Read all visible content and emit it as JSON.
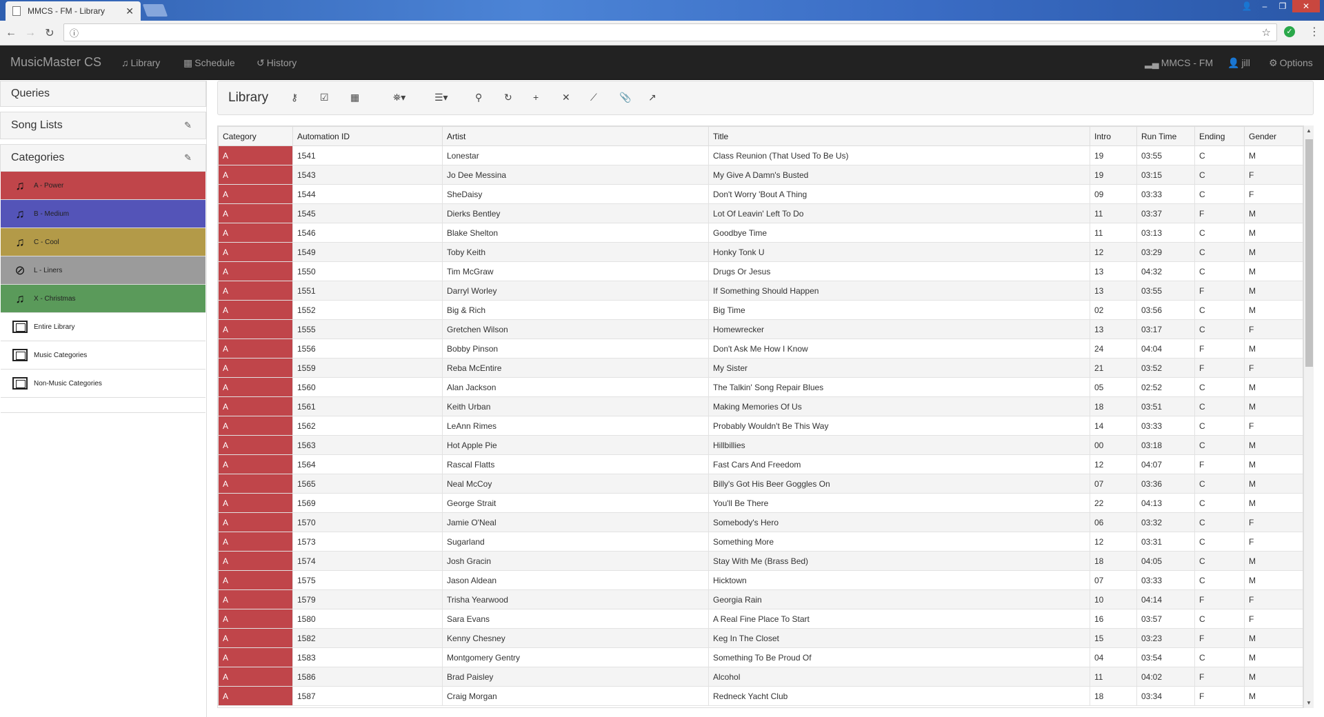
{
  "browser": {
    "tab_title": "MMCS - FM - Library",
    "tab_close": "✕",
    "url_icon": "ⓘ"
  },
  "navbar": {
    "brand": "MusicMaster CS",
    "library": "Library",
    "schedule": "Schedule",
    "history": "History",
    "station": "MMCS - FM",
    "user": "jill",
    "options": "Options"
  },
  "sidebar": {
    "queries": "Queries",
    "song_lists": "Song Lists",
    "categories": "Categories",
    "category_items": [
      {
        "label": "A - Power",
        "color": "#c0454a",
        "icon": "music-icon"
      },
      {
        "label": "B - Medium",
        "color": "#5454b8",
        "icon": "music-icon"
      },
      {
        "label": "C - Cool",
        "color": "#b39a48",
        "icon": "music-icon"
      },
      {
        "label": "L - Liners",
        "color": "#9b9b9b",
        "icon": "ban-icon"
      },
      {
        "label": "X - Christmas",
        "color": "#5a9a5a",
        "icon": "music-icon"
      },
      {
        "label": "Entire Library",
        "color": "#ffffff",
        "icon": "collection-icon"
      },
      {
        "label": "Music Categories",
        "color": "#ffffff",
        "icon": "collection-icon"
      },
      {
        "label": "Non-Music Categories",
        "color": "#ffffff",
        "icon": "collection-icon"
      }
    ]
  },
  "main": {
    "title": "Library",
    "columns": [
      "Category",
      "Automation ID",
      "Artist",
      "Title",
      "Intro",
      "Run Time",
      "Ending",
      "Gender"
    ],
    "rows": [
      [
        "A",
        "1541",
        "Lonestar",
        "Class Reunion (That Used To Be Us)",
        "19",
        "03:55",
        "C",
        "M"
      ],
      [
        "A",
        "1543",
        "Jo Dee Messina",
        "My Give A Damn's Busted",
        "19",
        "03:15",
        "C",
        "F"
      ],
      [
        "A",
        "1544",
        "SheDaisy",
        "Don't Worry 'Bout A Thing",
        "09",
        "03:33",
        "C",
        "F"
      ],
      [
        "A",
        "1545",
        "Dierks Bentley",
        "Lot Of Leavin' Left To Do",
        "11",
        "03:37",
        "F",
        "M"
      ],
      [
        "A",
        "1546",
        "Blake Shelton",
        "Goodbye Time",
        "11",
        "03:13",
        "C",
        "M"
      ],
      [
        "A",
        "1549",
        "Toby Keith",
        "Honky Tonk U",
        "12",
        "03:29",
        "C",
        "M"
      ],
      [
        "A",
        "1550",
        "Tim McGraw",
        "Drugs Or Jesus",
        "13",
        "04:32",
        "C",
        "M"
      ],
      [
        "A",
        "1551",
        "Darryl Worley",
        "If Something Should Happen",
        "13",
        "03:55",
        "F",
        "M"
      ],
      [
        "A",
        "1552",
        "Big & Rich",
        "Big Time",
        "02",
        "03:56",
        "C",
        "M"
      ],
      [
        "A",
        "1555",
        "Gretchen Wilson",
        "Homewrecker",
        "13",
        "03:17",
        "C",
        "F"
      ],
      [
        "A",
        "1556",
        "Bobby Pinson",
        "Don't Ask Me How I Know",
        "24",
        "04:04",
        "F",
        "M"
      ],
      [
        "A",
        "1559",
        "Reba McEntire",
        "My Sister",
        "21",
        "03:52",
        "F",
        "F"
      ],
      [
        "A",
        "1560",
        "Alan Jackson",
        "The Talkin' Song Repair Blues",
        "05",
        "02:52",
        "C",
        "M"
      ],
      [
        "A",
        "1561",
        "Keith Urban",
        "Making Memories Of Us",
        "18",
        "03:51",
        "C",
        "M"
      ],
      [
        "A",
        "1562",
        "LeAnn Rimes",
        "Probably Wouldn't Be This Way",
        "14",
        "03:33",
        "C",
        "F"
      ],
      [
        "A",
        "1563",
        "Hot Apple Pie",
        "Hillbillies",
        "00",
        "03:18",
        "C",
        "M"
      ],
      [
        "A",
        "1564",
        "Rascal Flatts",
        "Fast Cars And Freedom",
        "12",
        "04:07",
        "F",
        "M"
      ],
      [
        "A",
        "1565",
        "Neal McCoy",
        "Billy's Got His Beer Goggles On",
        "07",
        "03:36",
        "C",
        "M"
      ],
      [
        "A",
        "1569",
        "George Strait",
        "You'll Be There",
        "22",
        "04:13",
        "C",
        "M"
      ],
      [
        "A",
        "1570",
        "Jamie O'Neal",
        "Somebody's Hero",
        "06",
        "03:32",
        "C",
        "F"
      ],
      [
        "A",
        "1573",
        "Sugarland",
        "Something More",
        "12",
        "03:31",
        "C",
        "F"
      ],
      [
        "A",
        "1574",
        "Josh Gracin",
        "Stay With Me (Brass Bed)",
        "18",
        "04:05",
        "C",
        "M"
      ],
      [
        "A",
        "1575",
        "Jason Aldean",
        "Hicktown",
        "07",
        "03:33",
        "C",
        "M"
      ],
      [
        "A",
        "1579",
        "Trisha Yearwood",
        "Georgia Rain",
        "10",
        "04:14",
        "F",
        "F"
      ],
      [
        "A",
        "1580",
        "Sara Evans",
        "A Real Fine Place To Start",
        "16",
        "03:57",
        "C",
        "F"
      ],
      [
        "A",
        "1582",
        "Kenny Chesney",
        "Keg In The Closet",
        "15",
        "03:23",
        "F",
        "M"
      ],
      [
        "A",
        "1583",
        "Montgomery Gentry",
        "Something To Be Proud Of",
        "04",
        "03:54",
        "C",
        "M"
      ],
      [
        "A",
        "1586",
        "Brad Paisley",
        "Alcohol",
        "11",
        "04:02",
        "F",
        "M"
      ],
      [
        "A",
        "1587",
        "Craig Morgan",
        "Redneck Yacht Club",
        "18",
        "03:34",
        "F",
        "M"
      ]
    ]
  }
}
